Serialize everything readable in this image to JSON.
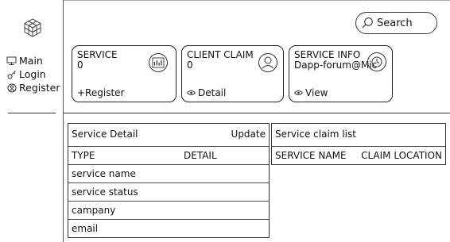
{
  "sidebar": {
    "nav": [
      {
        "label": "Main",
        "icon": "monitor-icon"
      },
      {
        "label": "Login",
        "icon": "key-icon"
      },
      {
        "label": "Register",
        "icon": "user-circle-icon"
      }
    ]
  },
  "search": {
    "label": "Search"
  },
  "cards": [
    {
      "title": "SERVICE",
      "value": "0",
      "action": "+Register",
      "icon": "chart-icon"
    },
    {
      "title": "CLIENT CLAIM",
      "value": "0",
      "action": "Detail",
      "icon": "user-icon"
    },
    {
      "title": "SERVICE INFO",
      "value": "Dapp-forum@Mic",
      "action": "View",
      "icon": "clock-icon"
    }
  ],
  "service_detail": {
    "title": "Service Detail",
    "update_label": "Update",
    "col_type": "TYPE",
    "col_detail": "DETAIL",
    "rows": [
      "service name",
      "service status",
      "campany",
      "email"
    ]
  },
  "claim_list": {
    "title": "Service claim list",
    "col_name": "SERVICE NAME",
    "col_location": "CLAIM LOCATION"
  }
}
